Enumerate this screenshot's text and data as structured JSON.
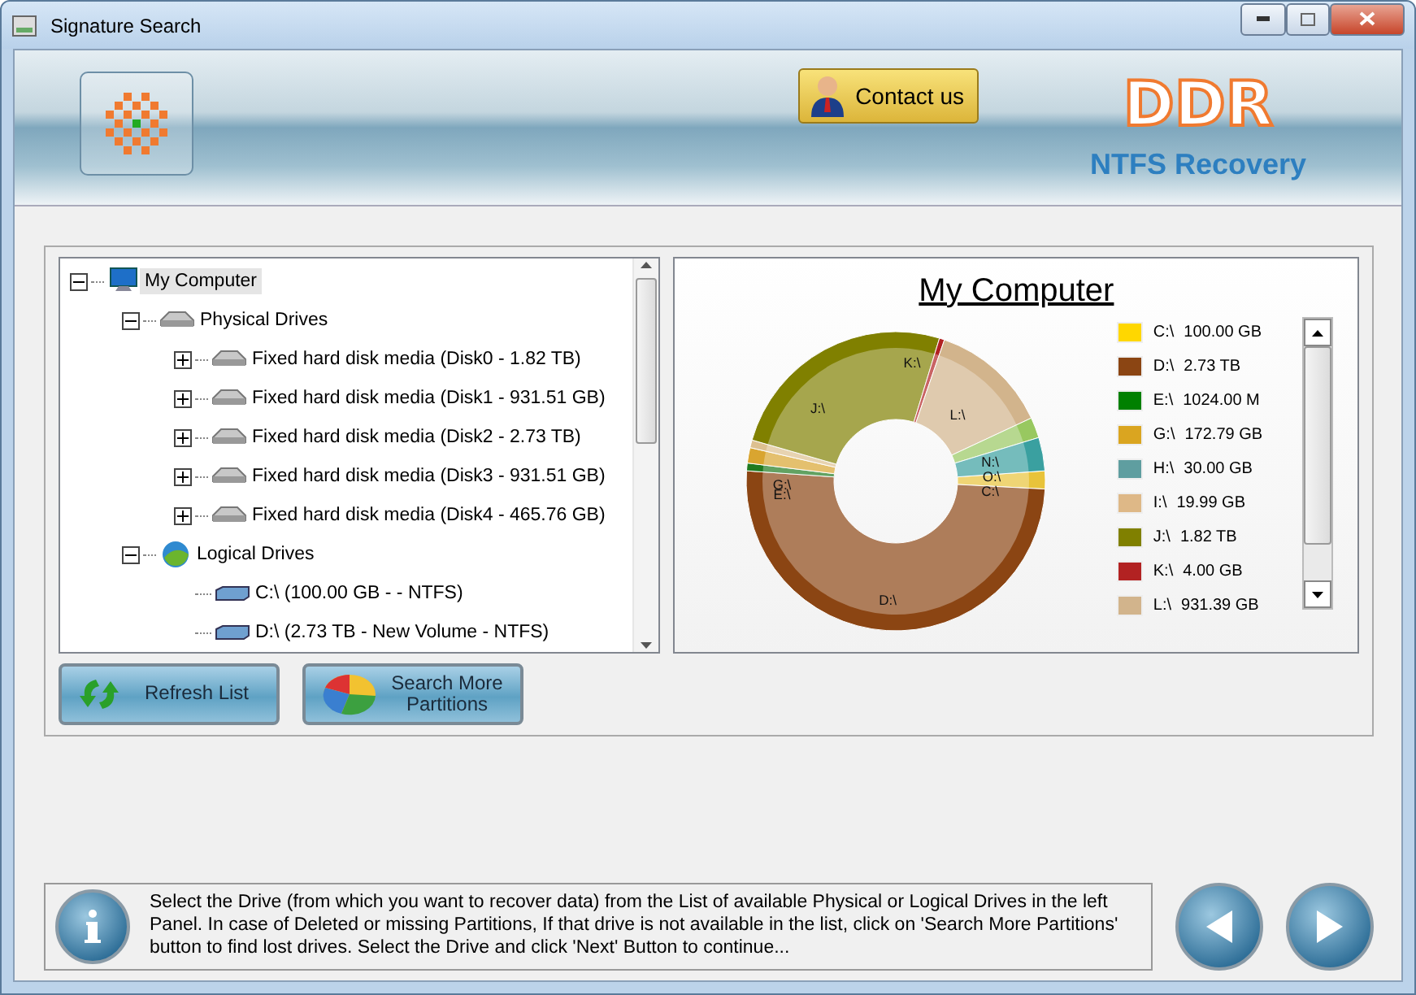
{
  "window": {
    "title": "Signature Search"
  },
  "header": {
    "contact_button": "Contact us",
    "brand": "DDR",
    "product": "NTFS Recovery"
  },
  "tree": [
    {
      "label": "My Computer",
      "kind": "computer",
      "expanded": true,
      "selected": true,
      "children": [
        {
          "label": "Physical Drives",
          "kind": "physical",
          "expanded": true,
          "selected": false,
          "children": [
            {
              "label": "Fixed hard disk media (Disk0 - 1.82 TB)",
              "kind": "disk",
              "expanded": false,
              "selected": false
            },
            {
              "label": "Fixed hard disk media (Disk1 - 931.51 GB)",
              "kind": "disk",
              "expanded": false,
              "selected": false
            },
            {
              "label": "Fixed hard disk media (Disk2 - 2.73 TB)",
              "kind": "disk",
              "expanded": false,
              "selected": false
            },
            {
              "label": "Fixed hard disk media (Disk3 - 931.51 GB)",
              "kind": "disk",
              "expanded": false,
              "selected": false
            },
            {
              "label": "Fixed hard disk media (Disk4 - 465.76 GB)",
              "kind": "disk",
              "expanded": false,
              "selected": false
            }
          ]
        },
        {
          "label": "Logical Drives",
          "kind": "logical",
          "expanded": true,
          "selected": false,
          "children": [
            {
              "label": "C:\\ (100.00 GB -  - NTFS)",
              "kind": "volume",
              "selected": false
            },
            {
              "label": "D:\\ (2.73 TB - New Volume - NTFS)",
              "kind": "volume",
              "selected": false
            }
          ]
        }
      ]
    }
  ],
  "chart": {
    "title": "My Computer",
    "slice_labels": [
      "J:\\",
      "K:\\",
      "L:\\",
      "N:\\",
      "O:\\",
      "C:\\",
      "D:\\",
      "G:\\",
      "E:\\"
    ],
    "legend": [
      {
        "drive": "C:\\",
        "size": "100.00 GB",
        "color": "#ffd700"
      },
      {
        "drive": "D:\\",
        "size": "2.73 TB",
        "color": "#8b4513"
      },
      {
        "drive": "E:\\",
        "size": "1024.00 M",
        "color": "#008000"
      },
      {
        "drive": "G:\\",
        "size": "172.79 GB",
        "color": "#daa520"
      },
      {
        "drive": "H:\\",
        "size": "30.00 GB",
        "color": "#5f9ea0"
      },
      {
        "drive": "I:\\",
        "size": "19.99 GB",
        "color": "#deb887"
      },
      {
        "drive": "J:\\",
        "size": "1.82 TB",
        "color": "#808000"
      },
      {
        "drive": "K:\\",
        "size": "4.00 GB",
        "color": "#b22222"
      },
      {
        "drive": "L:\\",
        "size": "931.39 GB",
        "color": "#d2b48c"
      }
    ]
  },
  "buttons": [
    "Refresh List",
    "Search More Partitions"
  ],
  "info": "Select the Drive (from which you want to recover data) from the List of available Physical or Logical Drives in the left Panel. In case of Deleted or missing Partitions, If that drive is not available in the list, click on 'Search More Partitions' button to find lost drives. Select the Drive and click 'Next' Button to continue..."
}
